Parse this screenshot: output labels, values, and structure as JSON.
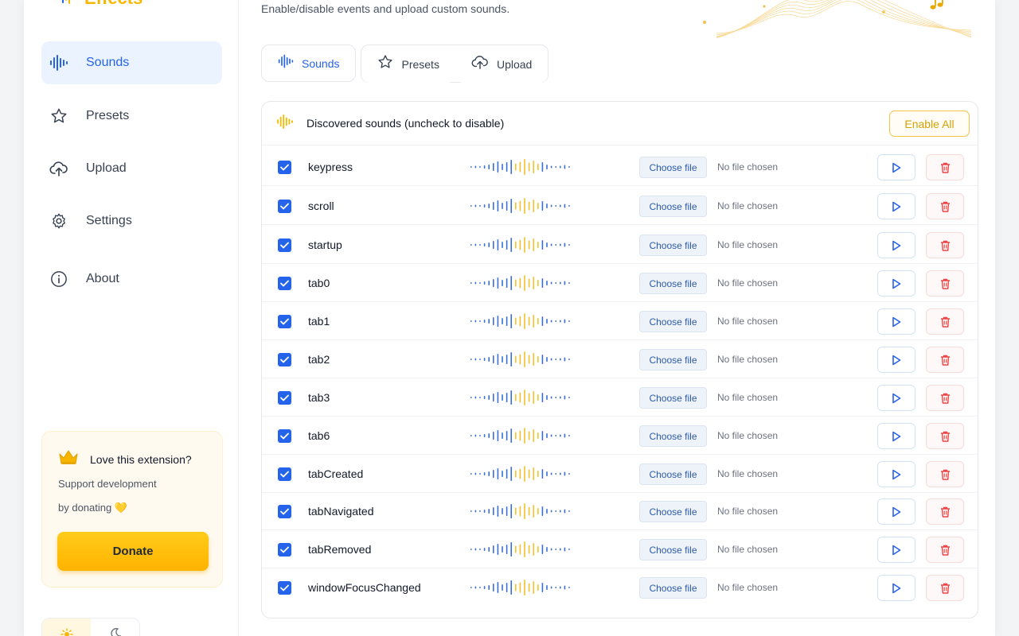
{
  "app": {
    "title": "Effects",
    "subtitle": "Enable/disable events and upload custom sounds."
  },
  "sidebar": {
    "items": [
      {
        "label": "Sounds",
        "icon": "waveform-icon",
        "active": true
      },
      {
        "label": "Presets",
        "icon": "star-icon",
        "active": false
      },
      {
        "label": "Upload",
        "icon": "cloud-upload-icon",
        "active": false
      },
      {
        "label": "Settings",
        "icon": "gear-icon",
        "active": false
      },
      {
        "label": "About",
        "icon": "info-icon",
        "active": false
      }
    ],
    "promo": {
      "title": "Love this extension?",
      "line1": "Support development",
      "line2": "by donating 💛",
      "donate_label": "Donate"
    }
  },
  "tabs": [
    {
      "label": "Sounds",
      "icon": "waveform-icon",
      "active": true
    },
    {
      "label": "Presets",
      "icon": "star-icon",
      "active": false
    },
    {
      "label": "Upload",
      "icon": "cloud-upload-icon",
      "active": false
    }
  ],
  "panel": {
    "title": "Discovered sounds (uncheck to disable)",
    "enable_all_label": "Enable All",
    "choose_label": "Choose file",
    "no_file_label": "No file chosen",
    "events": [
      {
        "name": "keypress",
        "checked": true
      },
      {
        "name": "scroll",
        "checked": true
      },
      {
        "name": "startup",
        "checked": true
      },
      {
        "name": "tab0",
        "checked": true
      },
      {
        "name": "tab1",
        "checked": true
      },
      {
        "name": "tab2",
        "checked": true
      },
      {
        "name": "tab3",
        "checked": true
      },
      {
        "name": "tab6",
        "checked": true
      },
      {
        "name": "tabCreated",
        "checked": true
      },
      {
        "name": "tabNavigated",
        "checked": true
      },
      {
        "name": "tabRemoved",
        "checked": true
      },
      {
        "name": "windowFocusChanged",
        "checked": true
      }
    ]
  },
  "colors": {
    "accent_blue": "#2563eb",
    "accent_yellow": "#f5b800",
    "delete_red": "#ef4444"
  }
}
